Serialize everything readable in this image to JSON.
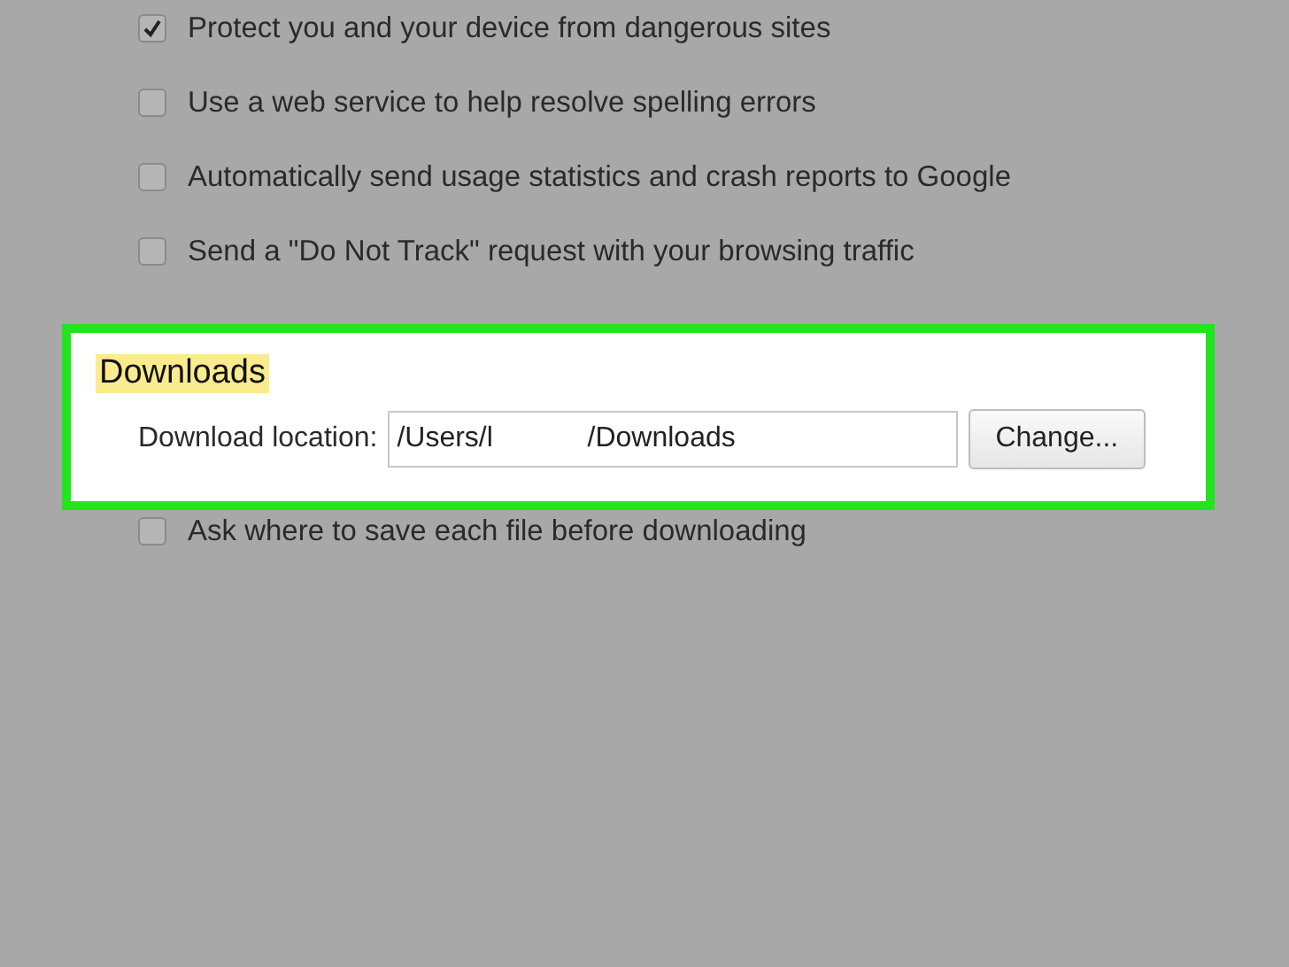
{
  "options_top": [
    {
      "label": "Protect you and your device from dangerous sites",
      "checked": true
    },
    {
      "label": "Use a web service to help resolve spelling errors",
      "checked": false
    },
    {
      "label": "Automatically send usage statistics and crash reports to Google",
      "checked": false
    },
    {
      "label": "Send a \"Do Not Track\" request with your browsing traffic",
      "checked": false
    }
  ],
  "downloads": {
    "heading": "Downloads",
    "location_label": "Download location:",
    "location_value": "/Users/l            /Downloads",
    "change_button": "Change..."
  },
  "options_bottom": [
    {
      "label": "Ask where to save each file before downloading",
      "checked": false
    }
  ]
}
